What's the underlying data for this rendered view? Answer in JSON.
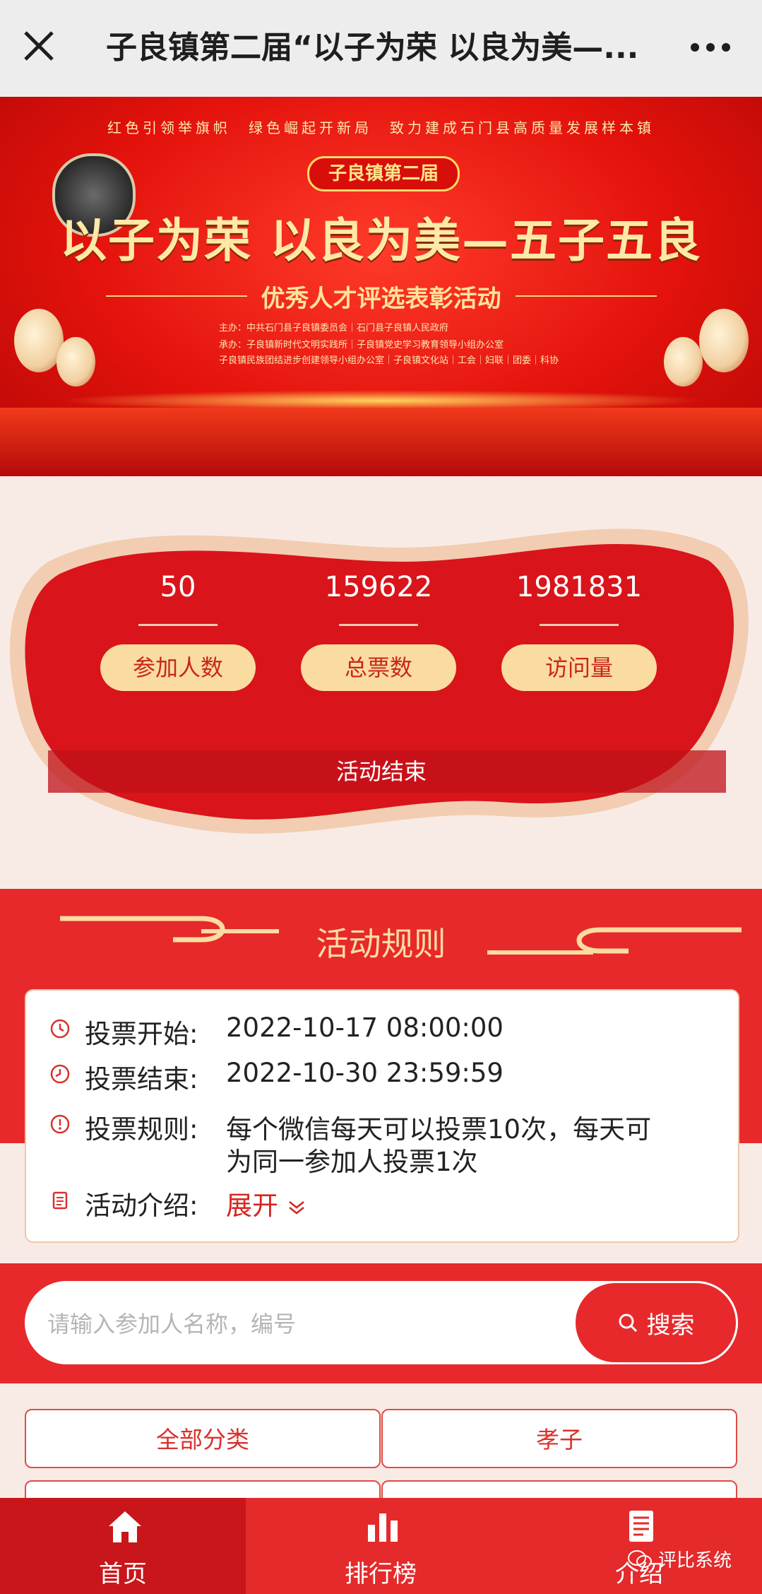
{
  "topbar": {
    "title": "子良镇第二届“以子为荣 以良为美—..."
  },
  "banner": {
    "slogan": "红色引领举旗帜　绿色崛起开新局　致力建成石门县高质量发展样本镇",
    "badge": "子良镇第二届",
    "headline": "以子为荣 以良为美—五子五良",
    "subline": "优秀人才评选表彰活动",
    "org_lines": [
      "主办：中共石门县子良镇委员会｜石门县子良镇人民政府",
      "承办：子良镇新时代文明实践所｜子良镇党史学习教育领导小组办公室",
      "子良镇民族团结进步创建领导小组办公室｜子良镇文化站｜工会｜妇联｜团委｜科协"
    ]
  },
  "stats": {
    "participants": "50",
    "participants_label": "参加人数",
    "total_votes": "159622",
    "total_votes_label": "总票数",
    "visits": "1981831",
    "visits_label": "访问量",
    "status": "活动结束"
  },
  "rules": {
    "title": "活动规则",
    "start_label": "投票开始:",
    "start_value": "2022-10-17 08:00:00",
    "end_label": "投票结束:",
    "end_value": "2022-10-30 23:59:59",
    "rule_label": "投票规则:",
    "rule_line1": "每个微信每天可以投票10次，每天可",
    "rule_line2": "为同一参加人投票1次",
    "intro_label": "活动介绍:",
    "intro_expand": "展开"
  },
  "search": {
    "placeholder": "请输入参加人名称，编号",
    "button": "搜索"
  },
  "categories": [
    "全部分类",
    "孝子"
  ],
  "tabs": [
    {
      "label": "首页",
      "icon": "home-icon"
    },
    {
      "label": "排行榜",
      "icon": "bar-chart-icon"
    },
    {
      "label": "介绍",
      "icon": "document-icon"
    }
  ],
  "watermark": "评比系统",
  "colors": {
    "primary_red": "#e7292b",
    "gold": "#fbdca0",
    "active_tab": "#c8161a"
  }
}
